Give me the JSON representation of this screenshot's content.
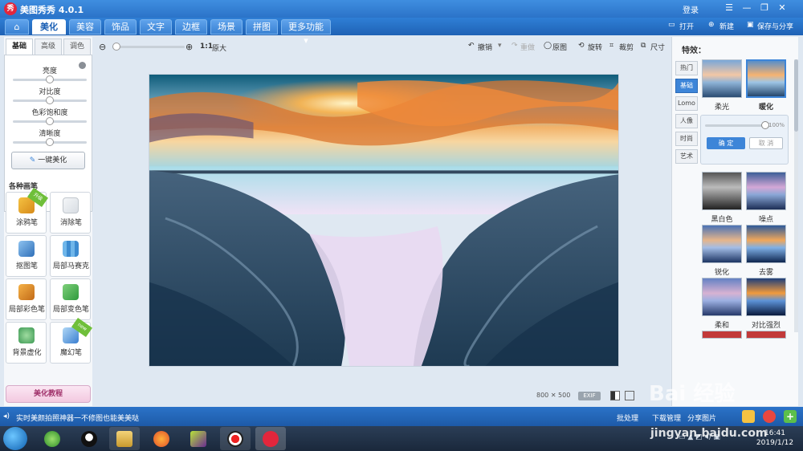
{
  "window": {
    "logo_text": "秀",
    "title": "美图秀秀 4.0.1",
    "login": "登录",
    "minimize": "—",
    "restore": "❐",
    "close": "✕",
    "menu_icon": "☰"
  },
  "main_tabs": [
    {
      "label": "⌂"
    },
    {
      "label": "美化"
    },
    {
      "label": "美容"
    },
    {
      "label": "饰品"
    },
    {
      "label": "文字"
    },
    {
      "label": "边框"
    },
    {
      "label": "场景"
    },
    {
      "label": "拼图"
    },
    {
      "label": "更多功能 ▾"
    }
  ],
  "file_actions": {
    "open": "打开",
    "new": "新建",
    "save_share": "保存与分享"
  },
  "left_panel": {
    "subtabs": [
      "基础",
      "高级",
      "调色"
    ],
    "sliders": [
      {
        "label": "亮度",
        "value": 0.5
      },
      {
        "label": "对比度",
        "value": 0.5
      },
      {
        "label": "色彩饱和度",
        "value": 0.5
      },
      {
        "label": "清晰度",
        "value": 0.5
      }
    ],
    "one_click": "一键美化",
    "brush_title": "各种画笔",
    "tools": [
      {
        "label": "涂鸦笔",
        "badge": "升级"
      },
      {
        "label": "消除笔",
        "badge": ""
      },
      {
        "label": "抠图笔",
        "badge": ""
      },
      {
        "label": "局部马赛克",
        "badge": ""
      },
      {
        "label": "局部彩色笔",
        "badge": ""
      },
      {
        "label": "局部变色笔",
        "badge": ""
      },
      {
        "label": "背景虚化",
        "badge": ""
      },
      {
        "label": "魔幻笔",
        "badge": "new"
      }
    ],
    "tutorial": "美化教程"
  },
  "toolbar": {
    "zoom_value": 0.05,
    "one_to_one": "1:1",
    "original_size": "原大",
    "undo": "撤销",
    "redo": "重做",
    "original": "原图",
    "rotate": "旋转",
    "crop": "裁剪",
    "resize": "尺寸"
  },
  "canvas": {
    "dimensions": "800 ✕ 500",
    "exif": "EXIF"
  },
  "effects_panel": {
    "title": "特效：",
    "categories": [
      "热门",
      "基础",
      "Lomo",
      "人像",
      "时尚",
      "艺术"
    ],
    "active_category": "基础",
    "thumbs": [
      {
        "label": "柔光"
      },
      {
        "label": "暖化"
      },
      {
        "label": "黑白色"
      },
      {
        "label": "噪点"
      },
      {
        "label": "锐化"
      },
      {
        "label": "去雾"
      },
      {
        "label": "柔和"
      },
      {
        "label": "对比强烈"
      }
    ],
    "intensity_value": 1.0,
    "intensity_text": "100%",
    "confirm": "确 定",
    "cancel": "取 消"
  },
  "status_bar": {
    "message": "实时美颜拍照神器一不修图也能美美哒",
    "batch": "批处理",
    "download": "下载管理",
    "share": "分享图片"
  },
  "taskbar": {
    "time": "16:41",
    "date": "2019/1/12"
  },
  "watermark": {
    "text": "Bai 经验",
    "url": "jingyan.baidu.com"
  },
  "colors": {
    "accent": "#2b73c8",
    "active_tab": "#ffffff",
    "effect_selected": "#3d85d8",
    "brand_red": "#e2263c"
  }
}
